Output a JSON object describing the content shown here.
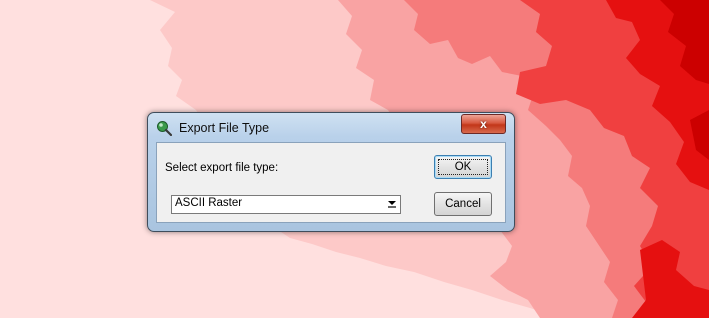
{
  "dialog": {
    "title": "Export File Type",
    "app_icon": "magnifier-globe-icon",
    "close_label": "x",
    "prompt": "Select export file type:",
    "file_type": {
      "selected": "ASCII Raster"
    },
    "ok_label": "OK",
    "cancel_label": "Cancel"
  },
  "colors": {
    "map_background": "#ffe0df",
    "map_shades": [
      "#ffe0df",
      "#fdc9c8",
      "#f9a3a3",
      "#f57b7b",
      "#f04040",
      "#e51010",
      "#cc0000"
    ],
    "close_button": "#c23619"
  }
}
